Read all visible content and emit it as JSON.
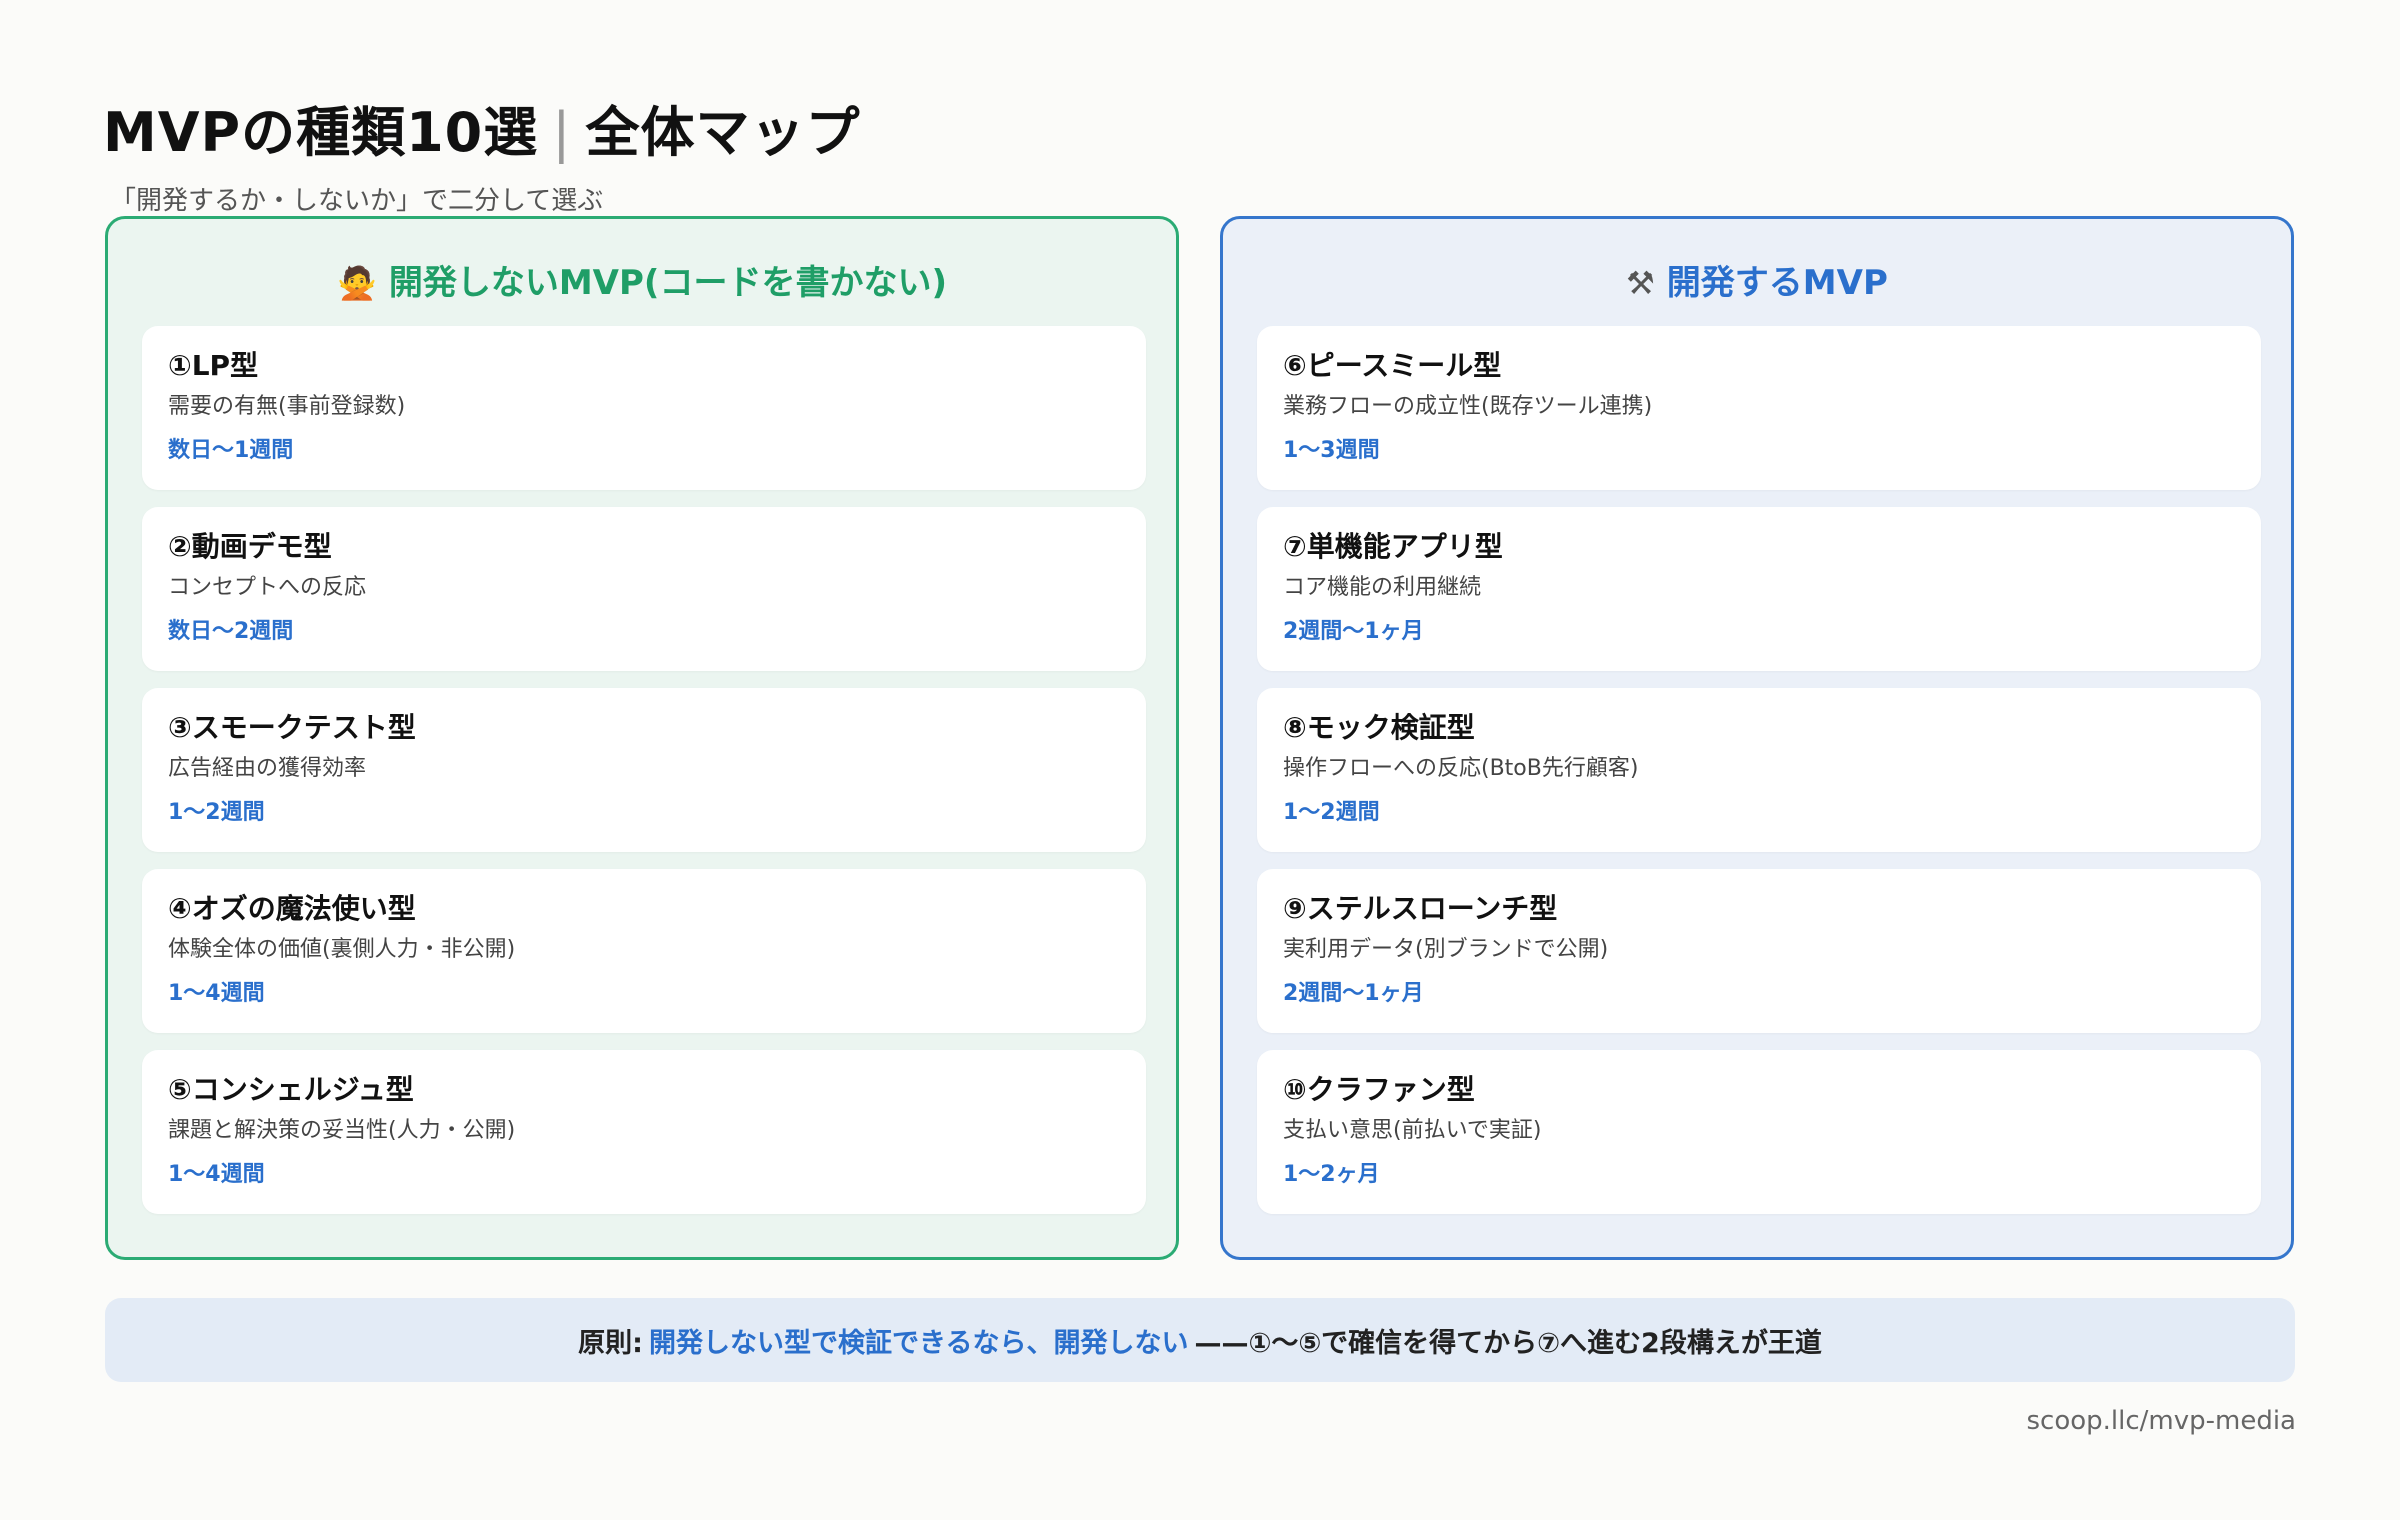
{
  "header": {
    "title_main": "MVPの種類10選",
    "title_sep": "|",
    "title_sub": "全体マップ",
    "subtitle": "「開発するか・しないか」で二分して選ぶ"
  },
  "left_panel": {
    "icon": "person-gesturing-no-icon",
    "heading": "開発しないMVP(コードを書かない)",
    "items": [
      {
        "title": "①LP型",
        "desc": "需要の有無(事前登録数)",
        "period": "数日〜1週間"
      },
      {
        "title": "②動画デモ型",
        "desc": "コンセプトへの反応",
        "period": "数日〜2週間"
      },
      {
        "title": "③スモークテスト型",
        "desc": "広告経由の獲得効率",
        "period": "1〜2週間"
      },
      {
        "title": "④オズの魔法使い型",
        "desc": "体験全体の価値(裏側人力・非公開)",
        "period": "1〜4週間"
      },
      {
        "title": "⑤コンシェルジュ型",
        "desc": "課題と解決策の妥当性(人力・公開)",
        "period": "1〜4週間"
      }
    ]
  },
  "right_panel": {
    "icon": "hammer-wrench-icon",
    "heading": "開発するMVP",
    "items": [
      {
        "title": "⑥ピースミール型",
        "desc": "業務フローの成立性(既存ツール連携)",
        "period": "1〜3週間"
      },
      {
        "title": "⑦単機能アプリ型",
        "desc": "コア機能の利用継続",
        "period": "2週間〜1ヶ月"
      },
      {
        "title": "⑧モック検証型",
        "desc": "操作フローへの反応(BtoB先行顧客)",
        "period": "1〜2週間"
      },
      {
        "title": "⑨ステルスローンチ型",
        "desc": "実利用データ(別ブランドで公開)",
        "period": "2週間〜1ヶ月"
      },
      {
        "title": "⑩クラファン型",
        "desc": "支払い意思(前払いで実証)",
        "period": "1〜2ヶ月"
      }
    ]
  },
  "principle": {
    "label": "原則:",
    "highlight": "開発しない型で検証できるなら、開発しない",
    "rest": "——①〜⑤で確信を得てから⑦へ進む2段構えが王道"
  },
  "footer": {
    "source": "scoop.llc/mvp-media"
  },
  "colors": {
    "green_accent": "#2bab74",
    "blue_accent": "#3576cc",
    "left_bg": "#ebf5f0",
    "right_bg": "#ebf0f8"
  }
}
